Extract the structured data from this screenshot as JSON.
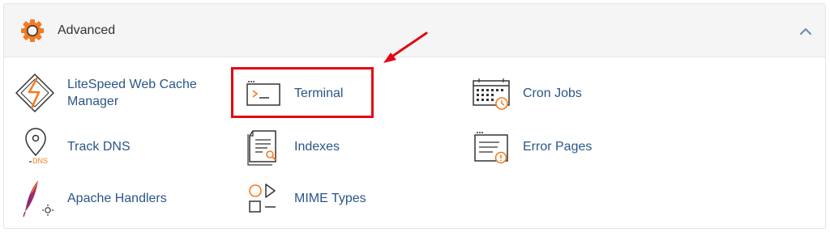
{
  "section": {
    "title": "Advanced",
    "icon": "gear-icon",
    "collapse_icon": "chevron-up-icon"
  },
  "items": [
    {
      "label_line1": "LiteSpeed Web Cache",
      "label_line2": "Manager",
      "icon": "litespeed-icon"
    },
    {
      "label": "Terminal",
      "icon": "terminal-icon"
    },
    {
      "label": "Cron Jobs",
      "icon": "cron-jobs-icon"
    },
    {
      "label": "Track DNS",
      "icon": "track-dns-icon",
      "icon_text": "DNS"
    },
    {
      "label": "Indexes",
      "icon": "indexes-icon"
    },
    {
      "label": "Error Pages",
      "icon": "error-pages-icon"
    },
    {
      "label": "Apache Handlers",
      "icon": "apache-feather-icon"
    },
    {
      "label": "MIME Types",
      "icon": "mime-types-icon"
    }
  ],
  "annotation": {
    "highlighted_item": "Terminal",
    "highlight_color": "#e30613"
  },
  "colors": {
    "accent": "#f47a20",
    "link": "#2a5687",
    "icon_stroke": "#333333"
  }
}
